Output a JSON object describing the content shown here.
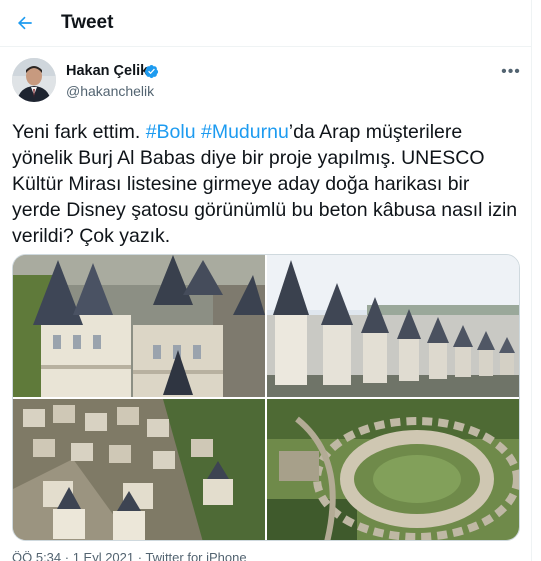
{
  "header": {
    "title": "Tweet",
    "back_icon": "back-arrow-icon"
  },
  "author": {
    "name": "Hakan Çelik",
    "handle": "@hakanchelik",
    "verified_icon": "verified-badge-icon",
    "more_icon": "more-options-icon",
    "more_label": "•••"
  },
  "tweet": {
    "text_parts": [
      {
        "t": "Yeni fark ettim. ",
        "tag": false
      },
      {
        "t": "#Bolu",
        "tag": true
      },
      {
        "t": " ",
        "tag": false
      },
      {
        "t": "#Mudurnu",
        "tag": true
      },
      {
        "t": "’da Arap müşterilere yönelik Burj Al Babas diye bir proje yapılmış. UNESCO Kültür Mirası listesine girmeye aday doğa harikası bir yerde Disney şatosu görünümlü bu beton kâbusa nasıl izin verildi? Çok yazık.",
        "tag": false
      }
    ],
    "timestamp": "ÖÖ 5:34 · 1 Eyl 2021 · Twitter for iPhone"
  },
  "colors": {
    "accent": "#1d9bf0",
    "text": "#0f1419",
    "secondary": "#536471",
    "border": "#eff3f4"
  },
  "media": {
    "count": 4
  }
}
